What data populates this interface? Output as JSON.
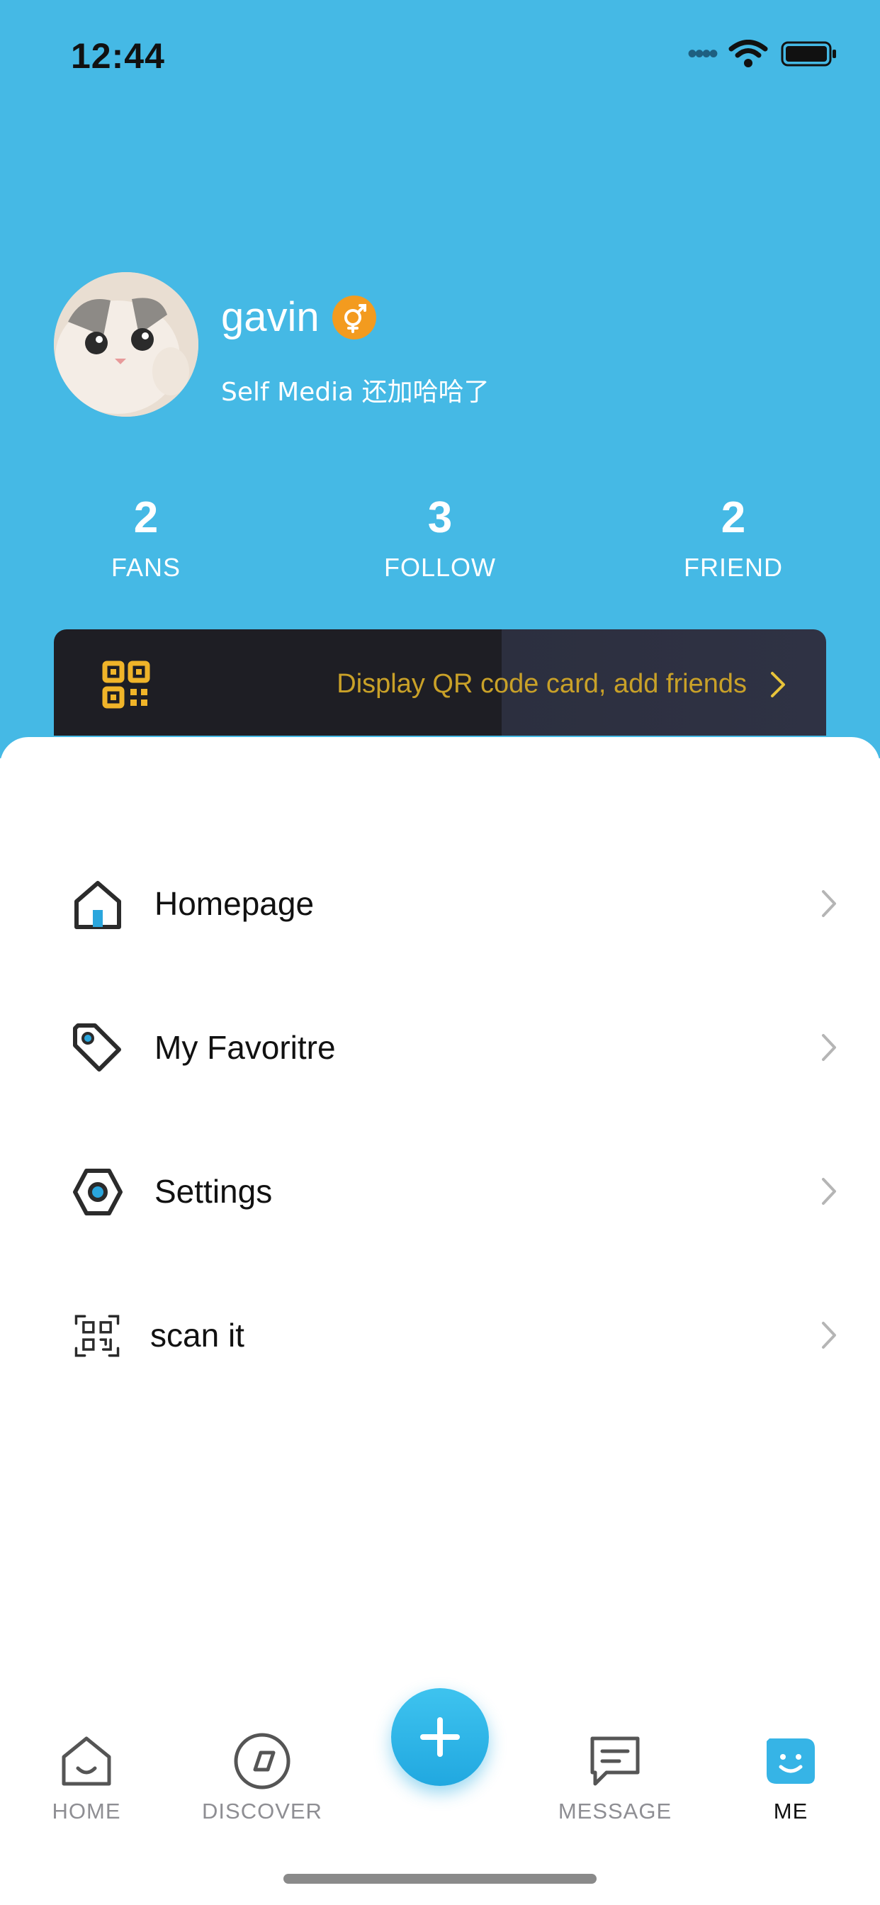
{
  "status_bar": {
    "time": "12:44"
  },
  "profile": {
    "username": "gavin",
    "bio": "Self Media 还加哈哈了",
    "gender_icon": "gender-icon",
    "badge_color": "#f39b1f"
  },
  "stats": [
    {
      "value": "2",
      "label": "FANS"
    },
    {
      "value": "3",
      "label": "FOLLOW"
    },
    {
      "value": "2",
      "label": "FRIEND"
    }
  ],
  "qr_card": {
    "text": "Display QR code card, add friends",
    "icon": "qr-code-icon"
  },
  "menu": [
    {
      "label": "Homepage",
      "icon": "home-icon"
    },
    {
      "label": "My Favoritre",
      "icon": "tag-icon"
    },
    {
      "label": "Settings",
      "icon": "settings-icon"
    },
    {
      "label": "scan it",
      "icon": "scan-icon"
    }
  ],
  "tabbar": {
    "tabs": [
      {
        "label": "HOME",
        "icon": "home-tab-icon",
        "active": false
      },
      {
        "label": "DISCOVER",
        "icon": "compass-icon",
        "active": false
      },
      {
        "label": "MESSAGE",
        "icon": "message-icon",
        "active": false
      },
      {
        "label": "ME",
        "icon": "me-icon",
        "active": true
      }
    ],
    "add_icon": "plus-icon"
  },
  "colors": {
    "header": "#45b9e5",
    "accent": "#21a8e0",
    "qr_text": "#c9a128"
  }
}
